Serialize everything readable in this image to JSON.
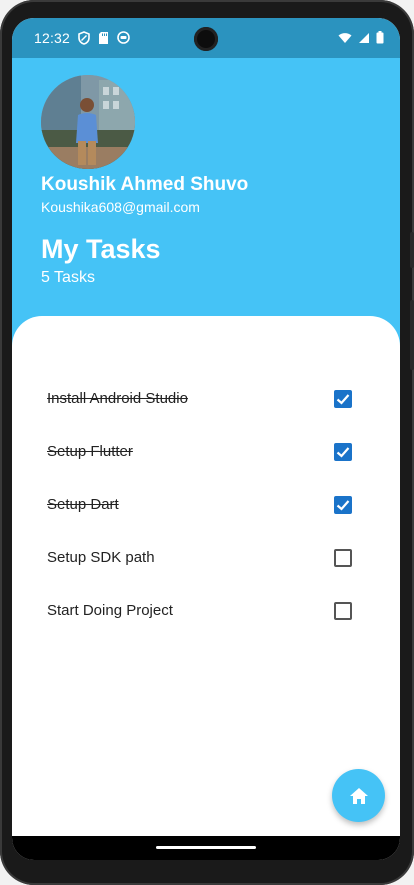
{
  "status_bar": {
    "time": "12:32",
    "left_icons": [
      "shield-icon",
      "sd-card-icon",
      "notification-icon"
    ],
    "right_icons": [
      "wifi-icon",
      "signal-icon",
      "battery-icon"
    ]
  },
  "profile": {
    "name": "Koushik Ahmed Shuvo",
    "email": "Koushika608@gmail.com",
    "avatar_icon": "profile-photo"
  },
  "tasks_header": {
    "title": "My Tasks",
    "count_label": "5 Tasks"
  },
  "tasks": [
    {
      "label": "Install Android Studio",
      "done": true
    },
    {
      "label": "Setup Flutter",
      "done": true
    },
    {
      "label": "Setup Dart",
      "done": true
    },
    {
      "label": "Setup SDK path",
      "done": false
    },
    {
      "label": "Start Doing Project",
      "done": false
    }
  ],
  "fab": {
    "icon": "home-icon"
  },
  "colors": {
    "header": "#45c3f6",
    "status_bar": "#2b93bf",
    "checkbox_checked": "#1a73c9"
  }
}
